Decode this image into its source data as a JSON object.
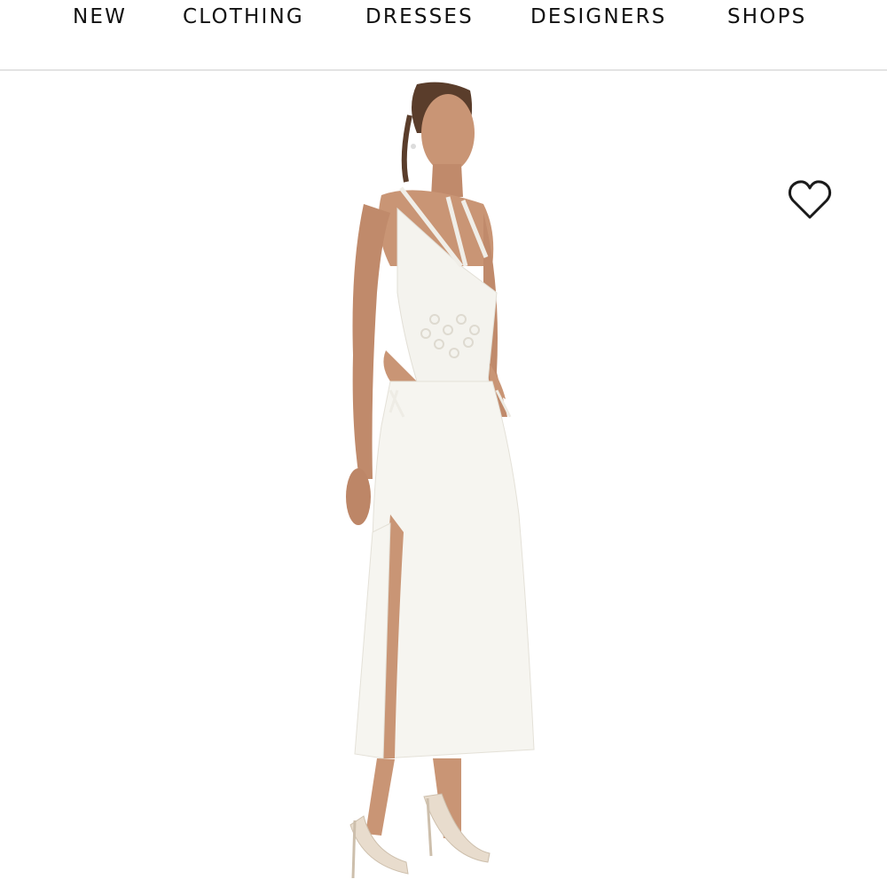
{
  "nav": {
    "items": [
      {
        "label": "NEW"
      },
      {
        "label": "CLOTHING"
      },
      {
        "label": "DRESSES"
      },
      {
        "label": "DESIGNERS"
      },
      {
        "label": "SHOPS"
      }
    ]
  },
  "product": {
    "image_subject": "model wearing a white crochet halter maxi dress with cut-outs and a side slit",
    "wishlist_icon": "heart-outline-icon"
  },
  "colors": {
    "nav_text": "#111111",
    "divider": "#e3e3e3",
    "background": "#ffffff",
    "dress": "#f6f5f0",
    "skin": "#c99575"
  }
}
